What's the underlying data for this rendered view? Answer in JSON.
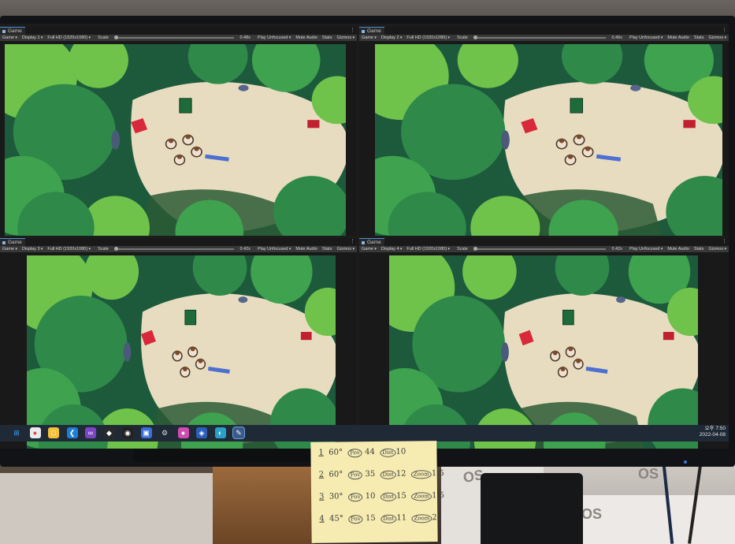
{
  "panes": [
    {
      "tab": "Game",
      "display": "Display 1",
      "resolution": "Full HD (1920x1080)",
      "scale_label": "Scale",
      "scale_value": "0.48x",
      "play_mode": "Play Unfocused",
      "mute": "Mute Audio",
      "stats": "Stats",
      "gizmos": "Gizmos",
      "game_dropdown": "Game"
    },
    {
      "tab": "Game",
      "display": "Display 2",
      "resolution": "Full HD (1920x1080)",
      "scale_label": "Scale",
      "scale_value": "0.46x",
      "play_mode": "Play Unfocused",
      "mute": "Mute Audio",
      "stats": "Stats",
      "gizmos": "Gizmos",
      "game_dropdown": "Game"
    },
    {
      "tab": "Game",
      "display": "Display 3",
      "resolution": "Full HD (1920x1080)",
      "scale_label": "Scale",
      "scale_value": "0.42x",
      "play_mode": "Play Unfocused",
      "mute": "Mute Audio",
      "stats": "Stats",
      "gizmos": "Gizmos",
      "game_dropdown": "Game"
    },
    {
      "tab": "Game",
      "display": "Display 4",
      "resolution": "Full HD (1920x1080)",
      "scale_label": "Scale",
      "scale_value": "0.42x",
      "play_mode": "Play Unfocused",
      "mute": "Mute Audio",
      "stats": "Stats",
      "gizmos": "Gizmos",
      "game_dropdown": "Game"
    }
  ],
  "taskbar": {
    "icons": [
      "windows-icon",
      "chrome-icon",
      "file-explorer-icon",
      "vscode-icon",
      "visual-studio-icon",
      "unity-icon",
      "github-icon",
      "cube-icon",
      "settings-icon",
      "app-icon",
      "shield-icon",
      "browser-icon",
      "notepad-icon"
    ],
    "clock_time": "오후 7:50",
    "clock_date": "2022-04-08"
  },
  "sticky_note": {
    "rows": [
      {
        "num": "1",
        "angle": "60°",
        "c1": "Fov",
        "v1": "44",
        "c2": "Dist",
        "v2": "10",
        "c3": "",
        "v3": ""
      },
      {
        "num": "2",
        "angle": "60°",
        "c1": "Fov",
        "v1": "35",
        "c2": "Dist",
        "v2": "12",
        "c3": "Zoom",
        "v3": "1.5"
      },
      {
        "num": "3",
        "angle": "30°",
        "c1": "Fov",
        "v1": "10",
        "c2": "Dist",
        "v2": "15",
        "c3": "Zoom",
        "v3": "1.5"
      },
      {
        "num": "4",
        "angle": "45°",
        "c1": "Fov",
        "v1": "15",
        "c2": "Dist",
        "v2": "11",
        "c3": "Zoom",
        "v3": "2"
      }
    ]
  },
  "boxes": {
    "label_a": "OS",
    "label_b": "OS",
    "label_c": "OS"
  },
  "colors": {
    "foliage_dark": "#1d5a3c",
    "foliage_light": "#6fc24a",
    "sand": "#e8dcc0",
    "toolbar": "#383838",
    "taskbar": "#1f2a36",
    "note": "#f6ecb2"
  }
}
